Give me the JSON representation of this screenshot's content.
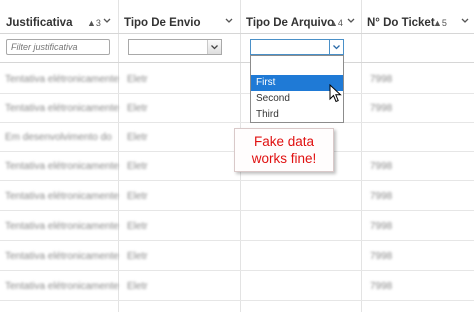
{
  "columns": [
    {
      "title": "Justificativa",
      "sort_index": "3"
    },
    {
      "title": "Tipo De Envio",
      "sort_index": ""
    },
    {
      "title": "Tipo De Arquivo",
      "sort_index": "4"
    },
    {
      "title": "N° Do Ticket",
      "sort_index": "5"
    }
  ],
  "filters": {
    "justificativa_placeholder": "Filter justificativa",
    "tipo_de_envio_value": "",
    "tipo_de_arquivo_value": ""
  },
  "dropdown": {
    "options": [
      "",
      "First",
      "Second",
      "Third"
    ],
    "selected": "First"
  },
  "rows": [
    {
      "justificativa": "Tentativa elétronicamente",
      "tipo_de_envio": "Eletr",
      "ticket": "7998"
    },
    {
      "justificativa": "Tentativa elétronicamente",
      "tipo_de_envio": "Eletr",
      "ticket": "7998"
    },
    {
      "justificativa": "Em desenvolvimento do",
      "tipo_de_envio": "Eletr",
      "ticket": ""
    },
    {
      "justificativa": "Tentativa elétronicamente",
      "tipo_de_envio": "Eletr",
      "ticket": "7998"
    },
    {
      "justificativa": "Tentativa elétronicamente",
      "tipo_de_envio": "Eletr",
      "ticket": "7998"
    },
    {
      "justificativa": "Tentativa elétronicamente",
      "tipo_de_envio": "Eletr",
      "ticket": "7998"
    },
    {
      "justificativa": "Tentativa elétronicamente",
      "tipo_de_envio": "Eletr",
      "ticket": "7998"
    },
    {
      "justificativa": "Tentativa elétronicamente",
      "tipo_de_envio": "Eletr",
      "ticket": "7998"
    }
  ],
  "callout": {
    "line1": "Fake data",
    "line2": "works fine!"
  },
  "colors": {
    "selection": "#1f7ad6",
    "callout_text": "#e01010"
  }
}
